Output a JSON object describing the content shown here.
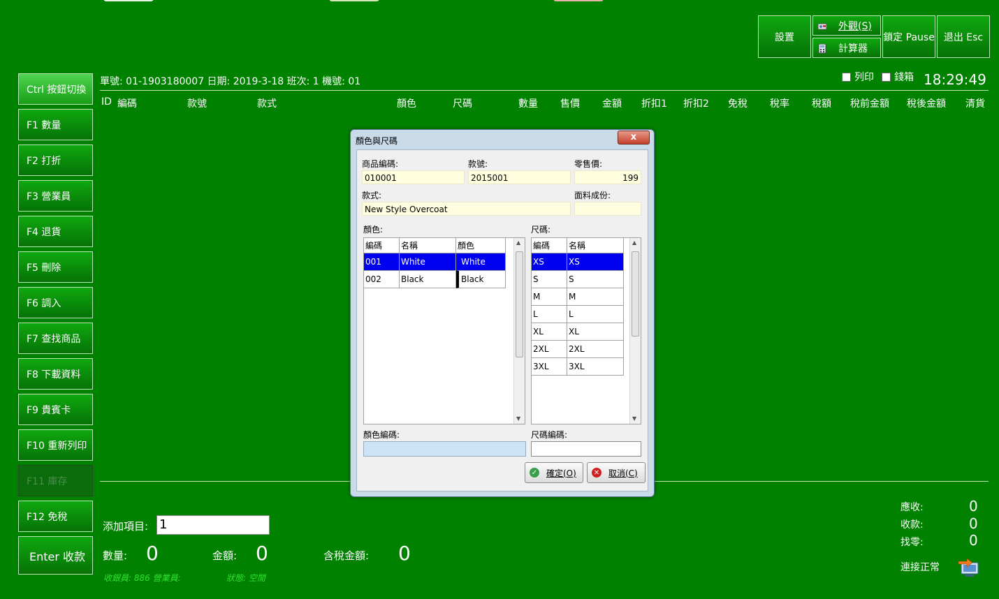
{
  "top_buttons": {
    "settings": "設置",
    "appearance": "外觀(S)",
    "calculator": "計算器",
    "lock": "鎖定 Pause",
    "exit": "退出 Esc"
  },
  "header": {
    "order_info": "單號: 01-1903180007 日期: 2019-3-18 班次: 1 機號: 01",
    "print_label": "列印",
    "cashbox_label": "錢箱",
    "clock": "18:29:49"
  },
  "columns": [
    "ID",
    "編碼",
    "款號",
    "款式",
    "顏色",
    "尺碼",
    "數量",
    "售價",
    "金額",
    "折扣1",
    "折扣2",
    "免稅",
    "稅率",
    "稅額",
    "稅前金額",
    "稅後金額",
    "清貨"
  ],
  "sidebar": [
    {
      "label": "Ctrl 按鈕切換",
      "state": "active"
    },
    {
      "label": "F1 數量",
      "state": "normal"
    },
    {
      "label": "F2 打折",
      "state": "normal"
    },
    {
      "label": "F3 營業員",
      "state": "normal"
    },
    {
      "label": "F4 退貨",
      "state": "normal"
    },
    {
      "label": "F5 刪除",
      "state": "normal"
    },
    {
      "label": "F6 調入",
      "state": "normal"
    },
    {
      "label": "F7 查找商品",
      "state": "normal"
    },
    {
      "label": "F8 下載資料",
      "state": "normal"
    },
    {
      "label": "F9 貴賓卡",
      "state": "normal"
    },
    {
      "label": "F10 重新列印",
      "state": "normal"
    },
    {
      "label": "F11 庫存",
      "state": "disabled"
    },
    {
      "label": "F12 免稅",
      "state": "normal"
    },
    {
      "label": "Enter 收款",
      "state": "normal"
    }
  ],
  "dialog": {
    "title": "顏色與尺碼",
    "close_glyph": "x",
    "product_code_label": "商品編碼:",
    "product_code": "010001",
    "style_no_label": "款號:",
    "style_no": "2015001",
    "retail_price_label": "零售價:",
    "retail_price": "199",
    "style_label": "款式:",
    "style": "New Style Overcoat",
    "fabric_label": "面料成份:",
    "fabric": "",
    "color_section_label": "顏色:",
    "size_section_label": "尺碼:",
    "color_headers": [
      "編碼",
      "名稱",
      "顏色"
    ],
    "colors": [
      {
        "code": "001",
        "name": "White",
        "color": "White",
        "swatch": "#0000f0",
        "selected": true
      },
      {
        "code": "002",
        "name": "Black",
        "color": "Black",
        "swatch": "#000000",
        "selected": false
      }
    ],
    "size_headers": [
      "編碼",
      "名稱"
    ],
    "sizes": [
      {
        "code": "XS",
        "name": "XS",
        "selected": true
      },
      {
        "code": "S",
        "name": "S",
        "selected": false
      },
      {
        "code": "M",
        "name": "M",
        "selected": false
      },
      {
        "code": "L",
        "name": "L",
        "selected": false
      },
      {
        "code": "XL",
        "name": "XL",
        "selected": false
      },
      {
        "code": "2XL",
        "name": "2XL",
        "selected": false
      },
      {
        "code": "3XL",
        "name": "3XL",
        "selected": false
      }
    ],
    "color_code_label": "顏色編碼:",
    "color_code_value": "",
    "size_code_label": "尺碼編碼:",
    "size_code_value": "",
    "ok_label": "確定(O)",
    "cancel_label": "取消(C)"
  },
  "bottom": {
    "add_item_label": "添加項目:",
    "add_item_value": "1",
    "qty_label": "數量:",
    "qty_value": "0",
    "amount_label": "金額:",
    "amount_value": "0",
    "taxed_amount_label": "含稅金額:",
    "taxed_amount_value": "0",
    "cashier_status": "收銀員: 886 營業員:",
    "state_status": "狀態: 空閒",
    "receivable_label": "應收:",
    "receivable_value": "0",
    "received_label": "收款:",
    "received_value": "0",
    "change_label": "找零:",
    "change_value": "0",
    "connection_label": "連接正常"
  },
  "colors": {
    "background": "#008200",
    "selection": "#0000f0",
    "field_bg": "#ffffe0"
  }
}
